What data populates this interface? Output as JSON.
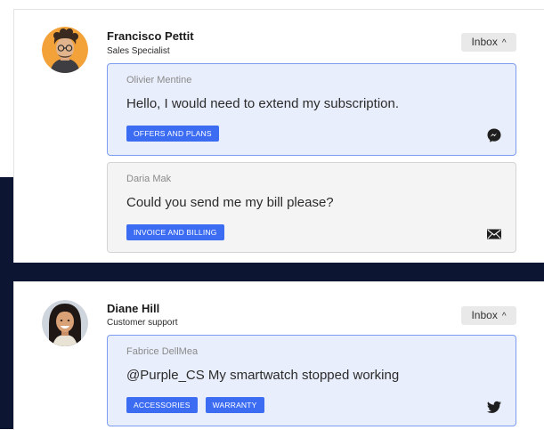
{
  "conversations": [
    {
      "agent_name": "Francisco Pettit",
      "agent_role": "Sales Specialist",
      "inbox_label": "Inbox",
      "messages": [
        {
          "author": "Olivier Mentine",
          "text": "Hello, I would need to extend my subscription.",
          "tags": [
            "OFFERS AND PLANS"
          ],
          "channel_icon": "messenger-icon",
          "state": "active"
        },
        {
          "author": "Daria Mak",
          "text": "Could you send me my bill please?",
          "tags": [
            "INVOICE AND BILLING"
          ],
          "channel_icon": "email-icon",
          "state": "idle"
        }
      ]
    },
    {
      "agent_name": "Diane Hill",
      "agent_role": "Customer support",
      "inbox_label": "Inbox",
      "messages": [
        {
          "author": "Fabrice DellMea",
          "text": "@Purple_CS My smartwatch stopped working",
          "tags": [
            "ACCESSORIES",
            "WARRANTY"
          ],
          "channel_icon": "twitter-icon",
          "state": "active"
        }
      ]
    }
  ],
  "colors": {
    "tag_background": "#3c6cf2",
    "active_message_background": "#e9eefc",
    "active_message_border": "#7d9cf0",
    "page_dark_band": "#0c1633"
  }
}
